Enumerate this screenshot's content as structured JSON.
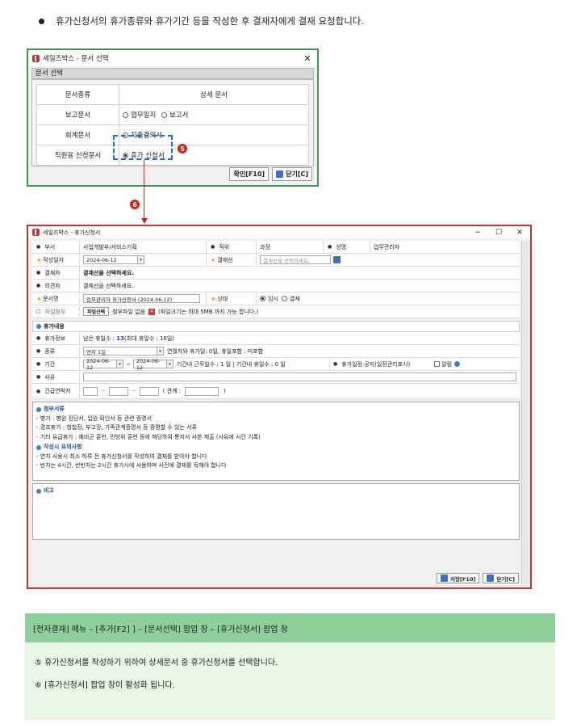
{
  "intro": "휴가신청서의 휴가종류와 휴가기간 등을 작성한 후 결재자에게 결재 요청합니다.",
  "dialog1": {
    "title": "세일즈박스 - 문서 선택",
    "section": "문서 선택",
    "col_type": "문서종류",
    "col_detail": "상세 문서",
    "rows": [
      {
        "type": "보고문서",
        "opts": [
          "업무일지",
          "보고서"
        ]
      },
      {
        "type": "회계문서",
        "opts": [
          "지출결의서"
        ]
      },
      {
        "type": "직원용 신청문서",
        "opts": [
          "휴가 신청서"
        ]
      }
    ],
    "ok": "확인[F10]",
    "close": "닫기[C]"
  },
  "badges": {
    "five": "5",
    "six": "6"
  },
  "dialog2": {
    "title": "세일즈박스 - 휴가신청서",
    "labels": {
      "dept": "부서",
      "position": "직위",
      "name": "성명",
      "date": "작성일자",
      "approver_label": "결재선",
      "approval": "결재자",
      "opinion": "의견자",
      "subject": "문서명",
      "state": "상태",
      "attach": "파일첨부",
      "vacation_info": "휴가정보",
      "kind": "종류",
      "period": "기간",
      "reason": "사유",
      "emergency": "긴급연락처"
    },
    "values": {
      "dept": "사업개발부/서비스기획",
      "position": "과장",
      "name": "업무관리자",
      "date": "2024-06-12",
      "approver_placeholder": "결재선을 선택하세요.",
      "approval": "결재선을 선택하세요.",
      "opinion": "결재선을 선택하세요.",
      "subject": "업무관리자 휴가신청서 (2024.06.12)",
      "state_temp": "임시",
      "state_approve": "결재",
      "file_btn": "파일선택",
      "file_info": "첨부파일 없음",
      "file_note": "(파일크기는 최대 5MB 까지 가능 합니다.)",
      "vac_pre": "남은 휴일수 : ",
      "vac_num": "13",
      "vac_post": " (최대 휴일수 : 16일)",
      "kind": "연차 1일",
      "kind_note": "연월차와 휴가일: 0일, 휴일포함 : 미포함",
      "start": "2024-06-12",
      "end": "2024-06-12",
      "tilde": "~",
      "period_note": "기간내 근무일수 : 1 일 | 기간내 휴일수 : 0 일",
      "schedule": "휴가일정 공지(일정관리표시)",
      "notify": "알림",
      "relation": "( 관계 :",
      "rparen": ")"
    },
    "section_vacation": "휴가내용",
    "docs_title": "첨부서류",
    "docs": [
      "- 병가 : 병원 진단서, 입원 확인서 등 관련 증명서",
      "- 경조휴가 : 청첩장, 부고장, 가족관계증명서 등 증명할 수 있는 서류",
      "- 기타 유급휴가 : 예비군 훈련, 민방위 훈련 등에 해당하여 통지서 사본 제출 (사유에 시간 기록)"
    ],
    "notes_title": "작성시 유의사항",
    "notes": [
      "- 연차 사용시 최소 하루 전 휴가신청서를 작성하여 결재를 받아야 합니다",
      "- 반차는 4시간, 반반차는 2시간 휴가시에 사용하며 사전에 결재를 득해야 합니다"
    ],
    "remark": "비고",
    "save": "저장[F10]",
    "close": "닫기[C]"
  },
  "bottom": {
    "header": "[전자결재] 메뉴 – [추가[F2] ] – [문서선택] 팝업 창 – [휴가신청서] 팝업 창",
    "line5": "⑤ 휴가신청서를 작성하기 위하여 상세문서 중 휴가신청서를 선택합니다.",
    "line6": "⑥ [휴가신청서] 팝업 창이 활성화 됩니다."
  }
}
